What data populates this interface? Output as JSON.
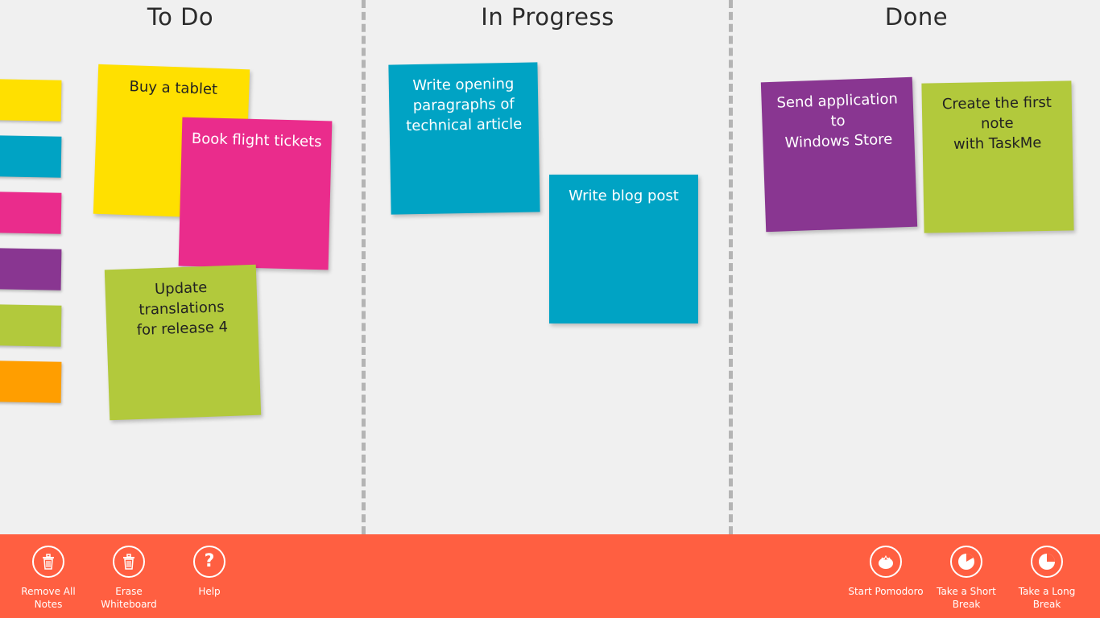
{
  "colors": {
    "background": "#f0f0f0",
    "appbar": "#ff5f41",
    "yellow": "#ffe000",
    "blue": "#00a3c4",
    "pink": "#ea2c8c",
    "purple": "#893691",
    "green": "#b2c93c",
    "orange": "#ff9e00"
  },
  "columns": {
    "todo": "To Do",
    "in_progress": "In Progress",
    "done": "Done"
  },
  "palette": [
    "yellow",
    "blue",
    "pink",
    "purple",
    "green",
    "orange"
  ],
  "notes": {
    "tablet": {
      "text": "Buy a tablet",
      "color": "yellow",
      "column": "To Do"
    },
    "flight": {
      "text": "Book flight tickets",
      "color": "pink",
      "column": "To Do"
    },
    "translations": {
      "text": "Update translations\nfor release 4",
      "color": "green",
      "column": "To Do"
    },
    "article": {
      "text": "Write opening\nparagraphs of\ntechnical article",
      "color": "blue",
      "column": "In Progress"
    },
    "blog": {
      "text": "Write blog post",
      "color": "blue",
      "column": "In Progress"
    },
    "store": {
      "text": "Send application to\nWindows Store",
      "color": "purple",
      "column": "Done"
    },
    "taskme": {
      "text": "Create the first note\nwith TaskMe",
      "color": "green",
      "column": "Done"
    }
  },
  "appbar": {
    "remove_all": {
      "label": "Remove All\nNotes",
      "icon": "trash-icon"
    },
    "erase": {
      "label": "Erase\nWhiteboard",
      "icon": "trash-icon"
    },
    "help": {
      "label": "Help",
      "icon": "help-icon"
    },
    "pomodoro": {
      "label": "Start Pomodoro",
      "icon": "tomato-icon"
    },
    "short_break": {
      "label": "Take a Short\nBreak",
      "icon": "short-break-icon"
    },
    "long_break": {
      "label": "Take a Long\nBreak",
      "icon": "long-break-icon"
    }
  }
}
